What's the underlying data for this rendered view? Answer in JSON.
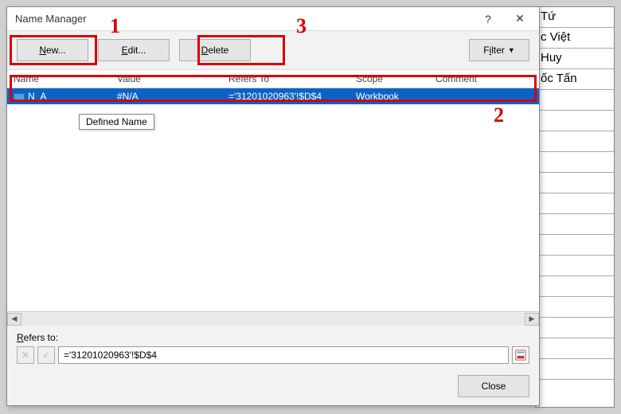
{
  "dialog_title": "Name Manager",
  "toolbar": {
    "new_label": "New...",
    "edit_label": "Edit...",
    "delete_label": "Delete",
    "filter_label": "Filter"
  },
  "columns": {
    "name": "Name",
    "value": "Value",
    "refers_to": "Refers To",
    "scope": "Scope",
    "comment": "Comment"
  },
  "rows": [
    {
      "name": "N_A",
      "value": "#N/A",
      "refers_to": "='31201020963'!$D$4",
      "scope": "Workbook",
      "comment": ""
    }
  ],
  "tooltip_text": "Defined Name",
  "refers_label": "Refers to:",
  "refers_value": "='31201020963'!$D$4",
  "close_label": "Close",
  "annotations": {
    "num1": "1",
    "num2": "2",
    "num3": "3"
  },
  "background_cells": [
    "Tứ",
    "c Việt",
    "Huy",
    "ốc Tấn"
  ]
}
